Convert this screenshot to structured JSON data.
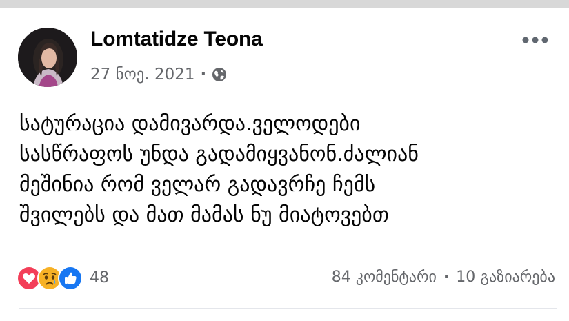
{
  "post": {
    "author": "Lomtatidze Teona",
    "date": "27 ნოე. 2021",
    "meta_separator": "·",
    "privacy_icon": "globe-icon",
    "more_icon": "ellipsis-icon",
    "text_lines": [
      "სატურაცია დამივარდა.ველოდები",
      "სასწრაფოს უნდა გადამიყვანონ.ძალიან",
      "მეშინია რომ ველარ გადავრჩე ჩემს",
      "შვილებს და მათ მამას ნუ მიატოვებთ"
    ]
  },
  "footer": {
    "reaction_icons": [
      "love-icon",
      "sad-icon",
      "like-icon"
    ],
    "reaction_count": "48",
    "comments": "84 კომენტარი",
    "separator": "·",
    "shares": "10 გაზიარება"
  },
  "colors": {
    "author": "#050505",
    "secondary": "#65676b",
    "love": "#f33e58",
    "sad": "#f7b125",
    "like": "#1877f2",
    "top_bar": "#d8d8d8"
  }
}
